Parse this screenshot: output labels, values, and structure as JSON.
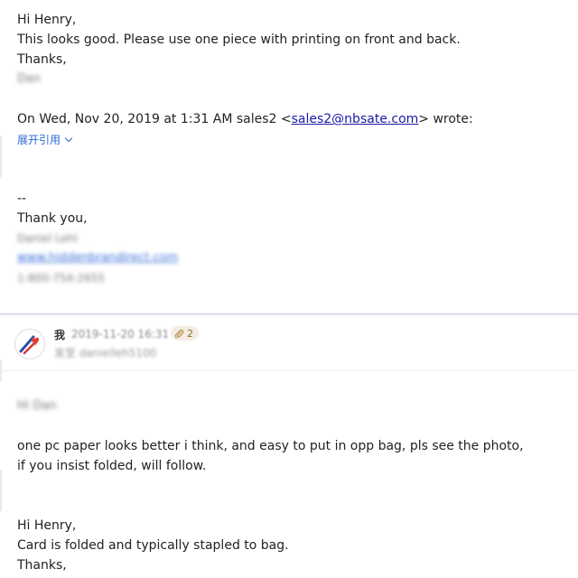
{
  "message1": {
    "greeting": "Hi Henry,",
    "body": "This looks good.  Please use one piece with printing on front and back.",
    "thanks": "Thanks,",
    "signature_name": "Dan",
    "quote_header_prefix": "On Wed, Nov 20, 2019 at 1:31 AM sales2 <",
    "quote_header_email": "sales2@nbsate.com",
    "quote_header_suffix": "> wrote:",
    "expand_quote_label": "展开引用",
    "sig_dashes": "--",
    "sig_thank_you": "Thank you,",
    "sig_full_name": "Daniel Lehl",
    "sig_website": "www.hiddenbrandirect.com",
    "sig_phone": "1-800-754-2655"
  },
  "reply_header": {
    "sender": "我",
    "timestamp": "2019-11-20 16:31",
    "attachment_count": "2",
    "recipient_line": "发至 danielleh5100"
  },
  "message2": {
    "greeting": "Hi Dan",
    "body_line1": "one pc paper looks better i think, and easy to put in opp bag, pls see the photo,",
    "body_line2": "if you insist folded, will follow.",
    "quoted_greeting": "Hi Henry,",
    "quoted_body": "Card is folded and typically stapled to bag.",
    "quoted_thanks": "Thanks,"
  }
}
